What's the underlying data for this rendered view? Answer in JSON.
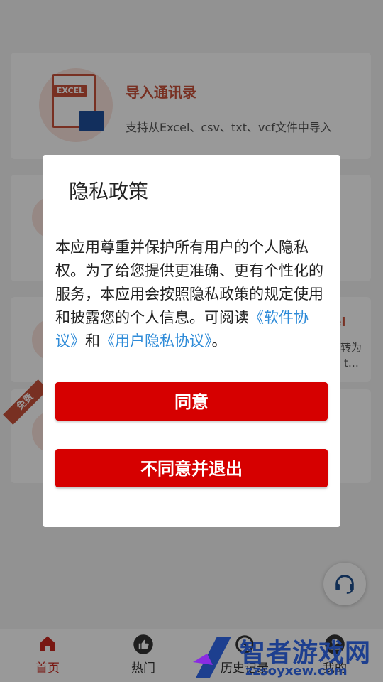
{
  "background": {
    "cards": [
      {
        "title": "导入通讯录",
        "subtitle": "支持从Excel、csv、txt、vcf文件中导入",
        "icon_tag": "EXCEL"
      },
      {
        "fragment_title": "el",
        "fragment_line1": "转为",
        "fragment_line2": "、t…"
      },
      {
        "ribbon": "免费"
      }
    ]
  },
  "dialog": {
    "title": "隐私政策",
    "body_text": "本应用尊重并保护所有用户的个人隐私权。为了给您提供更准确、更有个性化的服务，本应用会按照隐私政策的规定使用和披露您的个人信息。可阅读",
    "link_software": "《软件协议》",
    "connector": "和",
    "link_privacy": "《用户隐私协议》",
    "ending": "。",
    "agree_button": "同意",
    "disagree_button": "不同意并退出"
  },
  "fab": {
    "icon": "headset-icon"
  },
  "tabbar": {
    "tabs": [
      {
        "label": "首页",
        "icon": "home-icon",
        "active": true
      },
      {
        "label": "热门",
        "icon": "thumbs-up-icon",
        "active": false
      },
      {
        "label": "历史记录",
        "icon": "history-icon",
        "active": false
      },
      {
        "label": "我的",
        "icon": "user-icon",
        "active": false
      }
    ]
  },
  "watermark": {
    "text": "智者游戏网",
    "url": "zzsoyxew.com"
  },
  "colors": {
    "accent": "#d60000",
    "brand": "#c9503a",
    "link": "#2e8bd8",
    "tab_active": "#c9271e"
  }
}
